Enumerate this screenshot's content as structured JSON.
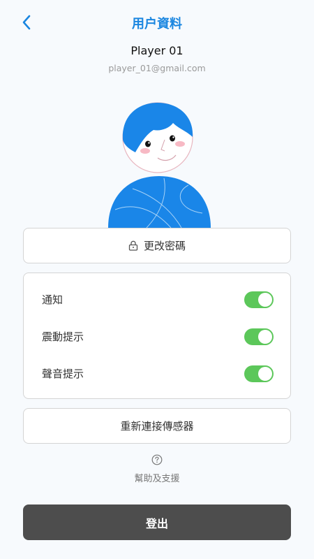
{
  "header": {
    "title": "用户資料",
    "back_icon": "chevron-left-icon",
    "accent_color": "#1a86e0"
  },
  "profile": {
    "name": "Player 01",
    "email": "player_01@gmail.com",
    "avatar_icon": "user-avatar-illustration"
  },
  "change_password": {
    "icon": "lock-icon",
    "label": "更改密碼"
  },
  "settings": {
    "items": [
      {
        "label": "通知",
        "enabled": true
      },
      {
        "label": "震動提示",
        "enabled": true
      },
      {
        "label": "聲音提示",
        "enabled": true
      }
    ],
    "toggle_on_color": "#5cc75a"
  },
  "reconnect": {
    "label": "重新連接傳感器"
  },
  "help": {
    "icon": "question-circle-icon",
    "label": "幫助及支援"
  },
  "logout": {
    "label": "登出",
    "background_color": "#4d4d4d"
  }
}
